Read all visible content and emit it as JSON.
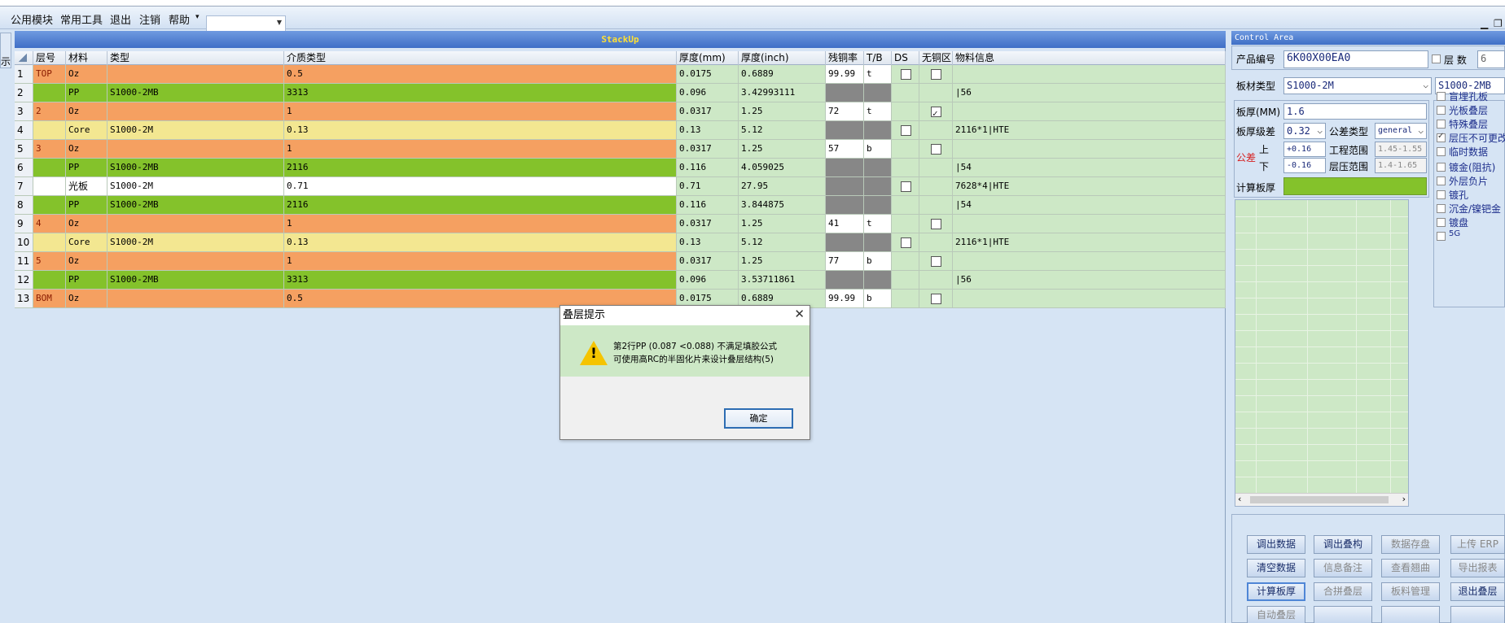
{
  "menu": {
    "items": [
      "公用模块",
      "常用工具",
      "退出",
      "注销",
      "帮助"
    ],
    "combo_value": ""
  },
  "left_tab_label": "示",
  "stackup": {
    "title": "StackUp",
    "headers": [
      "层号",
      "材料",
      "类型",
      "介质类型",
      "厚度(mm)",
      "厚度(inch)",
      "残铜率",
      "T/B",
      "DS",
      "无铜区",
      "物料信息"
    ],
    "rows": [
      {
        "idx": "1",
        "layer": "TOP",
        "mat": "Oz",
        "type": "",
        "diel": "0.5",
        "mm": "0.0175",
        "inch": "0.6889",
        "cu": "99.99",
        "tb": "t",
        "ds": false,
        "nocu": false,
        "info": "",
        "color": "#f5a061"
      },
      {
        "idx": "2",
        "layer": "",
        "mat": "PP",
        "type": "S1000-2MB",
        "diel": "3313",
        "mm": "0.096",
        "inch": "3.42993111",
        "cu": "",
        "tb": "",
        "ds": null,
        "nocu": null,
        "info": "|56",
        "color": "#84c22b"
      },
      {
        "idx": "3",
        "layer": "2",
        "mat": "Oz",
        "type": "",
        "diel": "1",
        "mm": "0.0317",
        "inch": "1.25",
        "cu": "72",
        "tb": "t",
        "ds": null,
        "nocu": true,
        "info": "",
        "color": "#f5a061"
      },
      {
        "idx": "4",
        "layer": "",
        "mat": "Core",
        "type": "S1000-2M",
        "diel": "0.13",
        "mm": "0.13",
        "inch": "5.12",
        "cu": "",
        "tb": "",
        "ds": false,
        "nocu": null,
        "info": "2116*1|HTE",
        "color": "#f3e791"
      },
      {
        "idx": "5",
        "layer": "3",
        "mat": "Oz",
        "type": "",
        "diel": "1",
        "mm": "0.0317",
        "inch": "1.25",
        "cu": "57",
        "tb": "b",
        "ds": null,
        "nocu": false,
        "info": "",
        "color": "#f5a061"
      },
      {
        "idx": "6",
        "layer": "",
        "mat": "PP",
        "type": "S1000-2MB",
        "diel": "2116",
        "mm": "0.116",
        "inch": "4.059025",
        "cu": "",
        "tb": "",
        "ds": null,
        "nocu": null,
        "info": "|54",
        "color": "#84c22b"
      },
      {
        "idx": "7",
        "layer": "",
        "mat": "光板",
        "type": "S1000-2M",
        "diel": "0.71",
        "mm": "0.71",
        "inch": "27.95",
        "cu": "",
        "tb": "",
        "ds": false,
        "nocu": null,
        "info": "7628*4|HTE",
        "color": "#ffffff"
      },
      {
        "idx": "8",
        "layer": "",
        "mat": "PP",
        "type": "S1000-2MB",
        "diel": "2116",
        "mm": "0.116",
        "inch": "3.844875",
        "cu": "",
        "tb": "",
        "ds": null,
        "nocu": null,
        "info": "|54",
        "color": "#84c22b"
      },
      {
        "idx": "9",
        "layer": "4",
        "mat": "Oz",
        "type": "",
        "diel": "1",
        "mm": "0.0317",
        "inch": "1.25",
        "cu": "41",
        "tb": "t",
        "ds": null,
        "nocu": false,
        "info": "",
        "color": "#f5a061"
      },
      {
        "idx": "10",
        "layer": "",
        "mat": "Core",
        "type": "S1000-2M",
        "diel": "0.13",
        "mm": "0.13",
        "inch": "5.12",
        "cu": "",
        "tb": "",
        "ds": false,
        "nocu": null,
        "info": "2116*1|HTE",
        "color": "#f3e791"
      },
      {
        "idx": "11",
        "layer": "5",
        "mat": "Oz",
        "type": "",
        "diel": "1",
        "mm": "0.0317",
        "inch": "1.25",
        "cu": "77",
        "tb": "b",
        "ds": null,
        "nocu": false,
        "info": "",
        "color": "#f5a061"
      },
      {
        "idx": "12",
        "layer": "",
        "mat": "PP",
        "type": "S1000-2MB",
        "diel": "3313",
        "mm": "0.096",
        "inch": "3.53711861",
        "cu": "",
        "tb": "",
        "ds": null,
        "nocu": null,
        "info": "|56",
        "color": "#84c22b"
      },
      {
        "idx": "13",
        "layer": "BOM",
        "mat": "Oz",
        "type": "",
        "diel": "0.5",
        "mm": "0.0175",
        "inch": "0.6889",
        "cu": "99.99",
        "tb": "b",
        "ds": null,
        "nocu": false,
        "info": "",
        "color": "#f5a061"
      }
    ]
  },
  "dialog": {
    "title": "叠层提示",
    "line1": "第2行PP (0.087 <0.088) 不满足填胶公式",
    "line2": "可使用高RC的半固化片来设计叠层结构(5)",
    "ok": "确定"
  },
  "control": {
    "title": "Control Area",
    "product_no_label": "产品编号",
    "product_no": "6K00X00EA0",
    "layers_label": "层 数",
    "layers": "6",
    "material_label": "板材类型",
    "material": "S1000-2M",
    "material2": "S1000-2MB",
    "thickness_label": "板厚(MM)",
    "thickness": "1.6",
    "grade_label": "板厚级差",
    "grade": "0.32",
    "tol_type_label": "公差类型",
    "tol_type": "general",
    "tol_label": "公差",
    "upper_label": "上",
    "lower_label": "下",
    "upper": "+0.16",
    "lower": "-0.16",
    "eng_range_label": "工程范围",
    "eng_range": "1.45-1.55",
    "press_range_label": "层压范围",
    "press_range": "1.4-1.65",
    "calc_label": "计算板厚",
    "options": [
      {
        "label": "盲埋孔板",
        "on": false
      },
      {
        "label": "光板叠层",
        "on": false
      },
      {
        "label": "特殊叠层",
        "on": false
      },
      {
        "label": "层压不可更改",
        "on": true
      },
      {
        "label": "临时数据",
        "on": false
      },
      {
        "label": "镀金(阻抗)",
        "on": false
      },
      {
        "label": "外层负片",
        "on": false
      },
      {
        "label": "镀孔",
        "on": false
      },
      {
        "label": "沉金/镍钯金",
        "on": false
      },
      {
        "label": "镀盘",
        "on": false
      },
      {
        "label": "5G",
        "on": false
      }
    ],
    "buttons": [
      [
        "调出数据",
        "调出叠构",
        "数据存盘",
        "上传 ERP"
      ],
      [
        "清空数据",
        "信息备注",
        "查看翘曲",
        "导出报表"
      ],
      [
        "计算板厚",
        "合拼叠层",
        "板料管理",
        "退出叠层"
      ],
      [
        "自动叠层",
        "",
        "",
        ""
      ]
    ]
  }
}
